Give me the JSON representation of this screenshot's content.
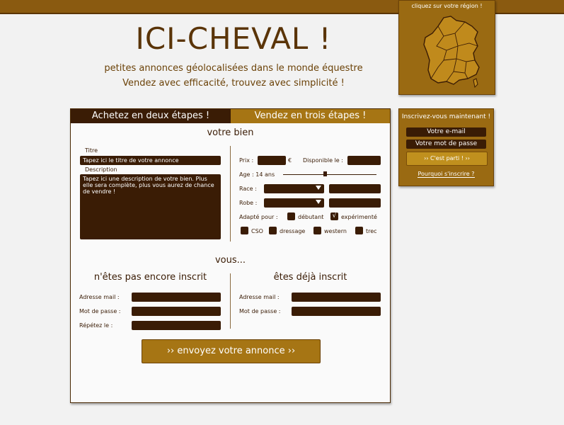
{
  "region": {
    "label": "cliquez sur votre région !"
  },
  "header": {
    "logo": "ICI-CHEVAL !",
    "tagline1": "petites annonces géolocalisées dans le monde équestre",
    "tagline2": "Vendez avec efficacité, trouvez avec simplicité !"
  },
  "tabs": {
    "buy": "Achetez en deux étapes !",
    "sell": "Vendez en trois étapes !"
  },
  "bien": {
    "title": "votre bien",
    "titre_label": "Titre",
    "titre_value": "Tapez ici le titre de votre annonce",
    "desc_label": "Description",
    "desc_value": "Tapez ici une description de votre bien. Plus elle sera complète, plus vous aurez de chance de vendre !",
    "prix_label": "Prix :",
    "currency": "€",
    "dispo_label": "Disponible le :",
    "age_label": "Age : 14 ans",
    "age_fraction": 0.45,
    "race_label": "Race :",
    "robe_label": "Robe :",
    "adapte_label": "Adapté pour :",
    "debutant": "débutant",
    "experimente": "expérimenté",
    "check_mark": "√",
    "cso": "CSO",
    "dressage": "dressage",
    "western": "western",
    "trec": "trec"
  },
  "vous": {
    "title": "vous...",
    "left_title": "n'êtes pas encore inscrit",
    "right_title": "êtes déjà inscrit",
    "adresse": "Adresse mail :",
    "motdepasse": "Mot de passe :",
    "repetez": "Répétez le :"
  },
  "submit": "›› envoyez votre annonce ››",
  "sidebar": {
    "title": "Inscrivez-vous maintenant !",
    "email": "Votre e-mail",
    "password": "Votre mot de passe",
    "button": "›› C'est parti ! ››",
    "link": "Pourquoi s'inscrire ?"
  },
  "colors": {
    "dark_brown": "#3a1c05",
    "gold": "#a67514",
    "accent": "#9a6a12"
  }
}
